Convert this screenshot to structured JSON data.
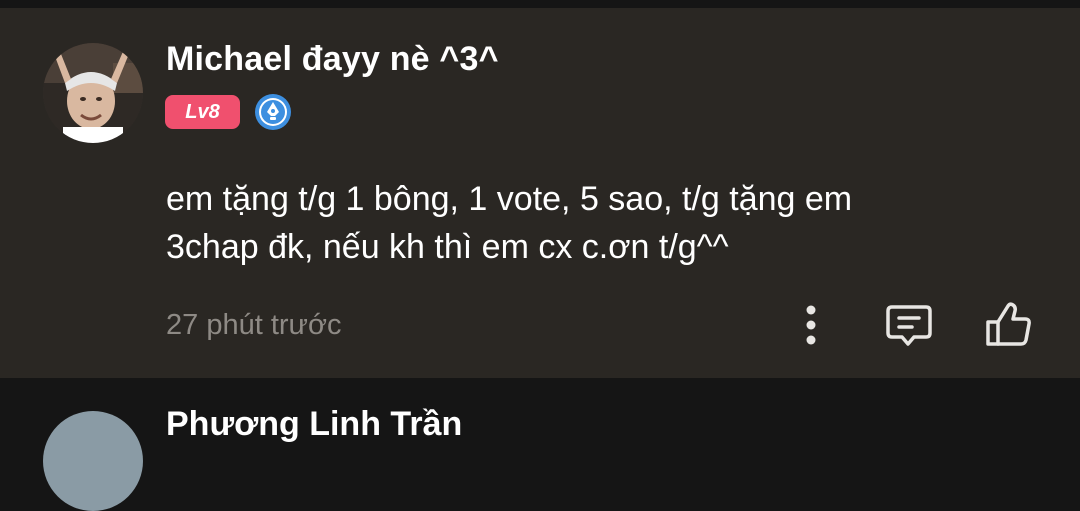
{
  "comment": {
    "username": "Michael đayy nè ^3^",
    "level_badge": "Lv8",
    "author_badge_icon": "pen-nib-icon",
    "text_lines": [
      "em tặng t/g 1 bông, 1 vote, 5 sao, t/g tặng em",
      "3chap đk, nếu kh thì em cx c.ơn t/g^^"
    ],
    "timestamp": "27 phút trước",
    "actions": [
      "more-icon",
      "reply-icon",
      "like-icon"
    ]
  },
  "next_comment": {
    "username": "Phương Linh Trần"
  },
  "colors": {
    "card_background": "#2a2723",
    "page_background": "#151515",
    "level_badge": "#f0506e",
    "author_badge": "#3d8fe0",
    "muted_text": "#8e8a85",
    "icon": "#e8e6e3"
  }
}
